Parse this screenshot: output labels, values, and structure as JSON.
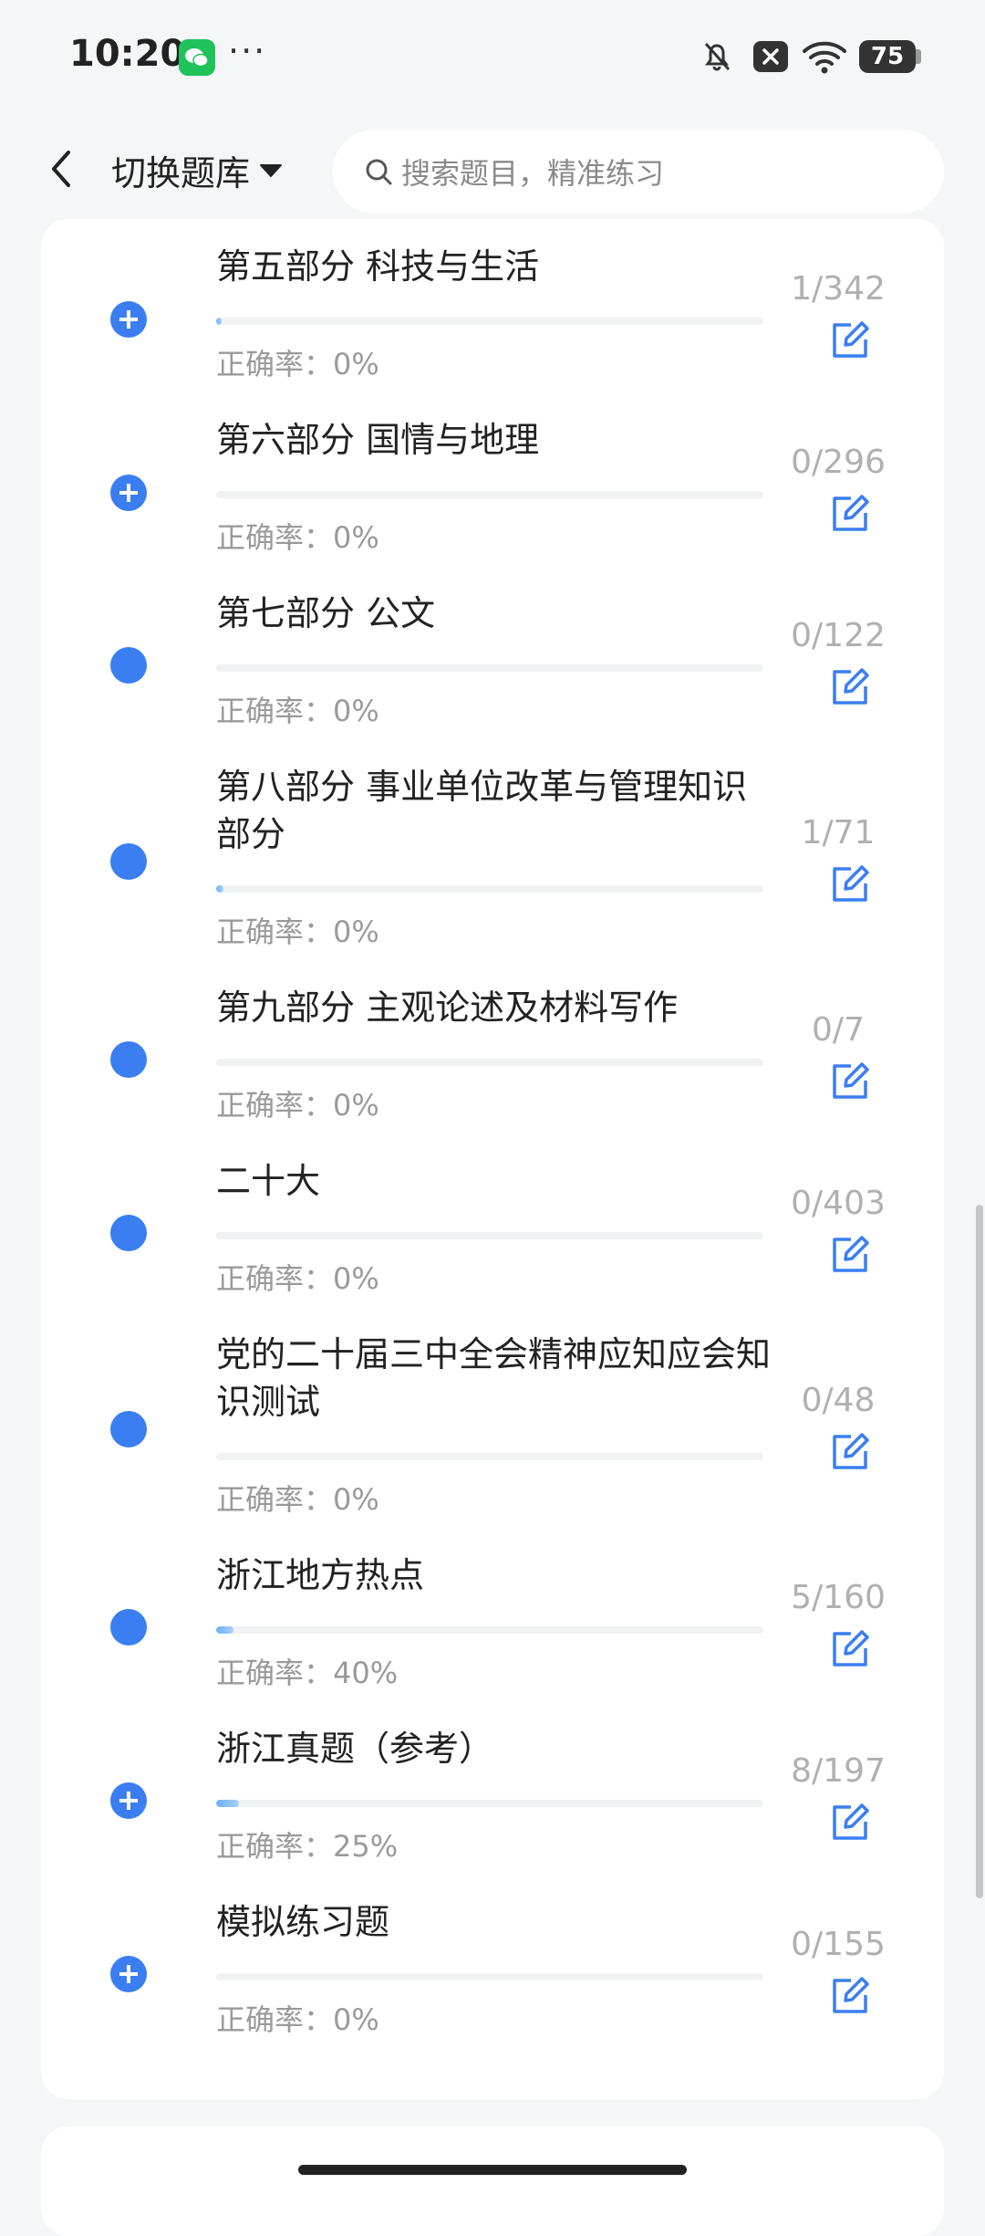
{
  "status": {
    "time": "10:20",
    "more": "···",
    "battery": "75"
  },
  "nav": {
    "bank_label": "切换题库",
    "search_placeholder": "搜索题目，精准练习"
  },
  "items": [
    {
      "title": "第五部分 科技与生活",
      "count": "1/342",
      "rate": "正确率：0%",
      "icon": "expand",
      "progress": 0.003
    },
    {
      "title": "第六部分 国情与地理",
      "count": "0/296",
      "rate": "正确率：0%",
      "icon": "expand",
      "progress": 0
    },
    {
      "title": "第七部分 公文",
      "count": "0/122",
      "rate": "正确率：0%",
      "icon": "dot",
      "progress": 0
    },
    {
      "title": "第八部分 事业单位改革与管理知识部分",
      "count": "1/71",
      "rate": "正确率：0%",
      "icon": "dot",
      "progress": 0.014
    },
    {
      "title": "第九部分 主观论述及材料写作",
      "count": "0/7",
      "rate": "正确率：0%",
      "icon": "dot",
      "progress": 0
    },
    {
      "title": "二十大",
      "count": "0/403",
      "rate": "正确率：0%",
      "icon": "dot",
      "progress": 0
    },
    {
      "title": "党的二十届三中全会精神应知应会知识测试",
      "count": "0/48",
      "rate": "正确率：0%",
      "icon": "dot",
      "progress": 0
    },
    {
      "title": "浙江地方热点",
      "count": "5/160",
      "rate": "正确率：40%",
      "icon": "dot",
      "progress": 0.031
    },
    {
      "title": "浙江真题（参考）",
      "count": "8/197",
      "rate": "正确率：25%",
      "icon": "expand",
      "progress": 0.041
    },
    {
      "title": "模拟练习题",
      "count": "0/155",
      "rate": "正确率：0%",
      "icon": "expand",
      "progress": 0
    }
  ],
  "colors": {
    "accent": "#3a7ef2",
    "progress": "#6fb0f7"
  }
}
